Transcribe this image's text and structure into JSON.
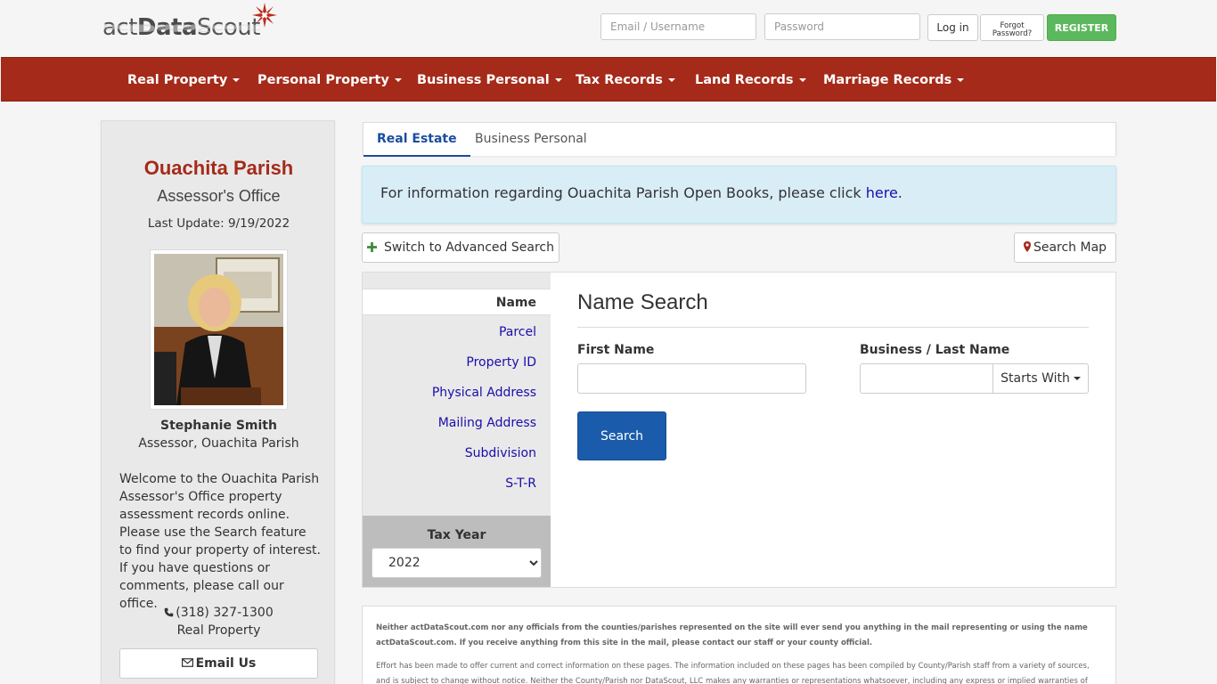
{
  "brand": {
    "logo_prefix": "act",
    "logo_bold": "Data",
    "logo_suffix": "Scout",
    "accent": "#a52a1a"
  },
  "login": {
    "email_placeholder": "Email / Username",
    "password_placeholder": "Password",
    "login_label": "Log in",
    "forgot_line1": "Forgot",
    "forgot_line2": "Password?",
    "register_label": "REGISTER"
  },
  "nav": {
    "items": [
      {
        "label": "Real Property"
      },
      {
        "label": "Personal Property"
      },
      {
        "label": "Business Personal"
      },
      {
        "label": "Tax Records"
      },
      {
        "label": "Land Records"
      },
      {
        "label": "Marriage Records"
      }
    ]
  },
  "sidebar": {
    "county": "Ouachita Parish",
    "office": "Assessor's Office",
    "last_update": "Last Update: 9/19/2022",
    "assessor_name": "Stephanie Smith",
    "assessor_title": "Assessor, Ouachita Parish",
    "welcome": "Welcome to the Ouachita Parish Assessor's Office property assessment records online. Please use the Search feature to find your property of interest. If you have questions or comments, please call our office.",
    "phone": "(318) 327-1300",
    "phone_dept": "Real Property",
    "email_label": "Email Us"
  },
  "tabs": [
    {
      "label": "Real Estate",
      "active": true
    },
    {
      "label": "Business Personal",
      "active": false
    }
  ],
  "info": {
    "text": "For information regarding Ouachita Parish Open Books, please click ",
    "link": "here",
    "suffix": "."
  },
  "actions": {
    "advanced_label": "Switch to Advanced Search",
    "map_label": "Search Map"
  },
  "search_nav": {
    "items": [
      {
        "label": "Name",
        "active": true
      },
      {
        "label": "Parcel"
      },
      {
        "label": "Property ID"
      },
      {
        "label": "Physical Address"
      },
      {
        "label": "Mailing Address"
      },
      {
        "label": "Subdivision"
      },
      {
        "label": "S-T-R"
      }
    ],
    "tax_year_label": "Tax Year",
    "tax_year_value": "2022"
  },
  "form": {
    "title": "Name Search",
    "first_name_label": "First Name",
    "last_name_label": "Business / Last Name",
    "first_name_value": "",
    "last_name_value": "",
    "match_mode": "Starts With",
    "search_label": "Search"
  },
  "disclaimer": {
    "bold": "Neither actDataScout.com nor any officials from the counties/parishes represented on the site will ever send you anything in the mail representing or using the name actDataScout.com. If you receive anything from this site in the mail, please contact our staff or your county official.",
    "normal": "Effort has been made to offer current and correct information on these pages. The information included on these pages has been compiled by County/Parish staff from a variety of sources, and is subject to change without notice. Neither the County/Parish nor DataScout, LLC makes any warranties or representations whatsoever, including any express or implied warranties of"
  }
}
